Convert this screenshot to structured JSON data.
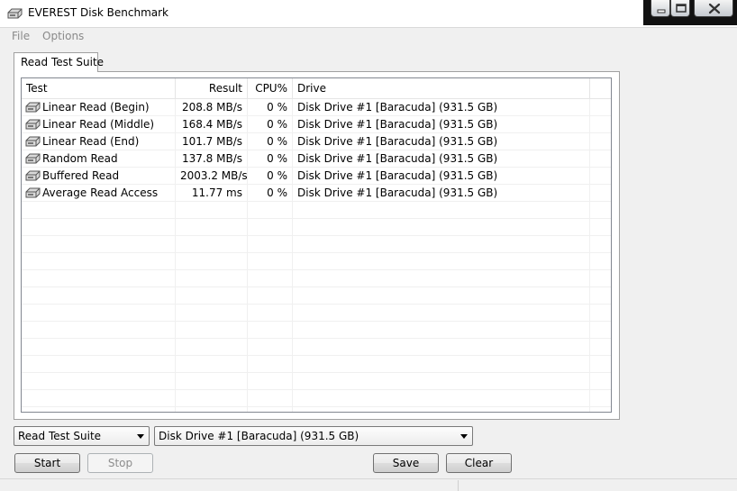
{
  "window": {
    "title": "EVEREST Disk Benchmark",
    "icon": "hard-drive-icon"
  },
  "menu": {
    "items": [
      "File",
      "Options"
    ]
  },
  "tabs": [
    {
      "label": "Read Test Suite",
      "active": true
    }
  ],
  "grid": {
    "columns": [
      "Test",
      "Result",
      "CPU%",
      "Drive"
    ],
    "rows": [
      {
        "test": "Linear Read (Begin)",
        "result": "208.8 MB/s",
        "cpu": "0 %",
        "drive": "Disk Drive #1  [Baracuda]  (931.5 GB)"
      },
      {
        "test": "Linear Read (Middle)",
        "result": "168.4 MB/s",
        "cpu": "0 %",
        "drive": "Disk Drive #1  [Baracuda]  (931.5 GB)"
      },
      {
        "test": "Linear Read (End)",
        "result": "101.7 MB/s",
        "cpu": "0 %",
        "drive": "Disk Drive #1  [Baracuda]  (931.5 GB)"
      },
      {
        "test": "Random Read",
        "result": "137.8 MB/s",
        "cpu": "0 %",
        "drive": "Disk Drive #1  [Baracuda]  (931.5 GB)"
      },
      {
        "test": "Buffered Read",
        "result": "2003.2 MB/s",
        "cpu": "0 %",
        "drive": "Disk Drive #1  [Baracuda]  (931.5 GB)"
      },
      {
        "test": "Average Read Access",
        "result": "11.77 ms",
        "cpu": "0 %",
        "drive": "Disk Drive #1  [Baracuda]  (931.5 GB)"
      }
    ]
  },
  "controls": {
    "suite_value": "Read Test Suite",
    "drive_value": "Disk Drive #1  [Baracuda]  (931.5 GB)",
    "start_label": "Start",
    "stop_label": "Stop",
    "save_label": "Save",
    "clear_label": "Clear"
  }
}
